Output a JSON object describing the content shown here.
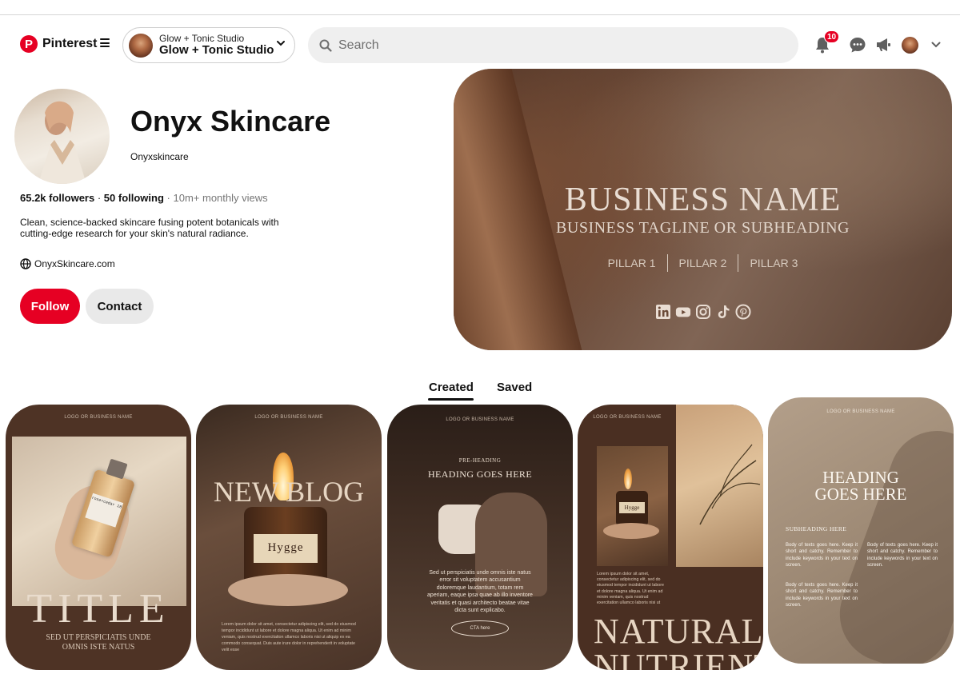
{
  "header": {
    "brand": "Pinterest",
    "account": {
      "name_small": "Glow + Tonic Studio",
      "name_big": "Glow + Tonic Studio"
    },
    "search_placeholder": "Search",
    "notification_count": "10"
  },
  "profile": {
    "name": "Onyx Skincare",
    "username": "Onyxskincare",
    "followers": "65.2k followers",
    "following": "50 following",
    "monthly_views": "10m+ monthly views",
    "bio": "Clean, science-backed skincare fusing potent botanicals with cutting-edge research for your skin's natural radiance.",
    "website": "OnyxSkincare.com",
    "follow_label": "Follow",
    "contact_label": "Contact"
  },
  "cover": {
    "title": "BUSINESS NAME",
    "subtitle": "BUSINESS TAGLINE OR SUBHEADING",
    "pillars": [
      "PILLAR 1",
      "PILLAR 2",
      "PILLAR 3"
    ]
  },
  "tabs": {
    "created": "Created",
    "saved": "Saved"
  },
  "pins": [
    {
      "logo": "LOGO OR BUSINESS NAME",
      "bottle_label": "rose+cedar 18",
      "title": "TITLE",
      "subtitle": "SED UT PERSPICIATIS UNDE OMNIS ISTE NATUS"
    },
    {
      "logo": "LOGO OR BUSINESS NAME",
      "title": "NEW BLOG",
      "jar_label": "Hygge",
      "body": "Lorem ipsum dolor sit amet, consectetur adipiscing elit, sed do eiusmod tempor incididunt ut labore et dolore magna aliqua. Ut enim ad minim veniam, quis nostrud exercitation ullamco laboris nisi ut aliquip ex ea commodo consequat. Duis aute irure dolor in reprehenderit in voluptate velit esse"
    },
    {
      "logo": "LOGO OR BUSINESS NAME",
      "pre_heading": "PRE-HEADING",
      "heading": "HEADING GOES HERE",
      "body": "Sed ut perspiciatis unde omnis iste natus error sit voluptatem accusantium doloremque laudantium, totam rem aperiam, eaque ipsa quae ab illo inventore veritatis et quasi architecto beatae vitae dicta sunt explicabo.",
      "cta": "CTA here"
    },
    {
      "logo": "LOGO OR BUSINESS NAME",
      "body": "Lorem ipsum dolor sit amet, consectetur adipiscing elit, sed do eiusmod tempor incididunt ut labore et dolore magna aliqua. Ut enim ad minim veniam, quis nostrud exercitation ullamco laboris nisi ut",
      "jar_label": "Hygge",
      "title_line1": "NATURAL",
      "title_line2": "NUTRIENTS"
    },
    {
      "logo": "LOGO OR BUSINESS NAME",
      "heading_line1": "HEADING",
      "heading_line2": "GOES HERE",
      "subheading": "SUBHEADING HERE",
      "body_a": "Body of texts goes here. Keep it short and catchy. Remember to include keywords in your text on screen.",
      "body_b": "Body of texts goes here. Keep it short and catchy. Remember to include keywords in your text on screen.",
      "body_c": "Body of texts goes here. Keep it short and catchy. Remember to include keywords in your text on screen."
    }
  ]
}
